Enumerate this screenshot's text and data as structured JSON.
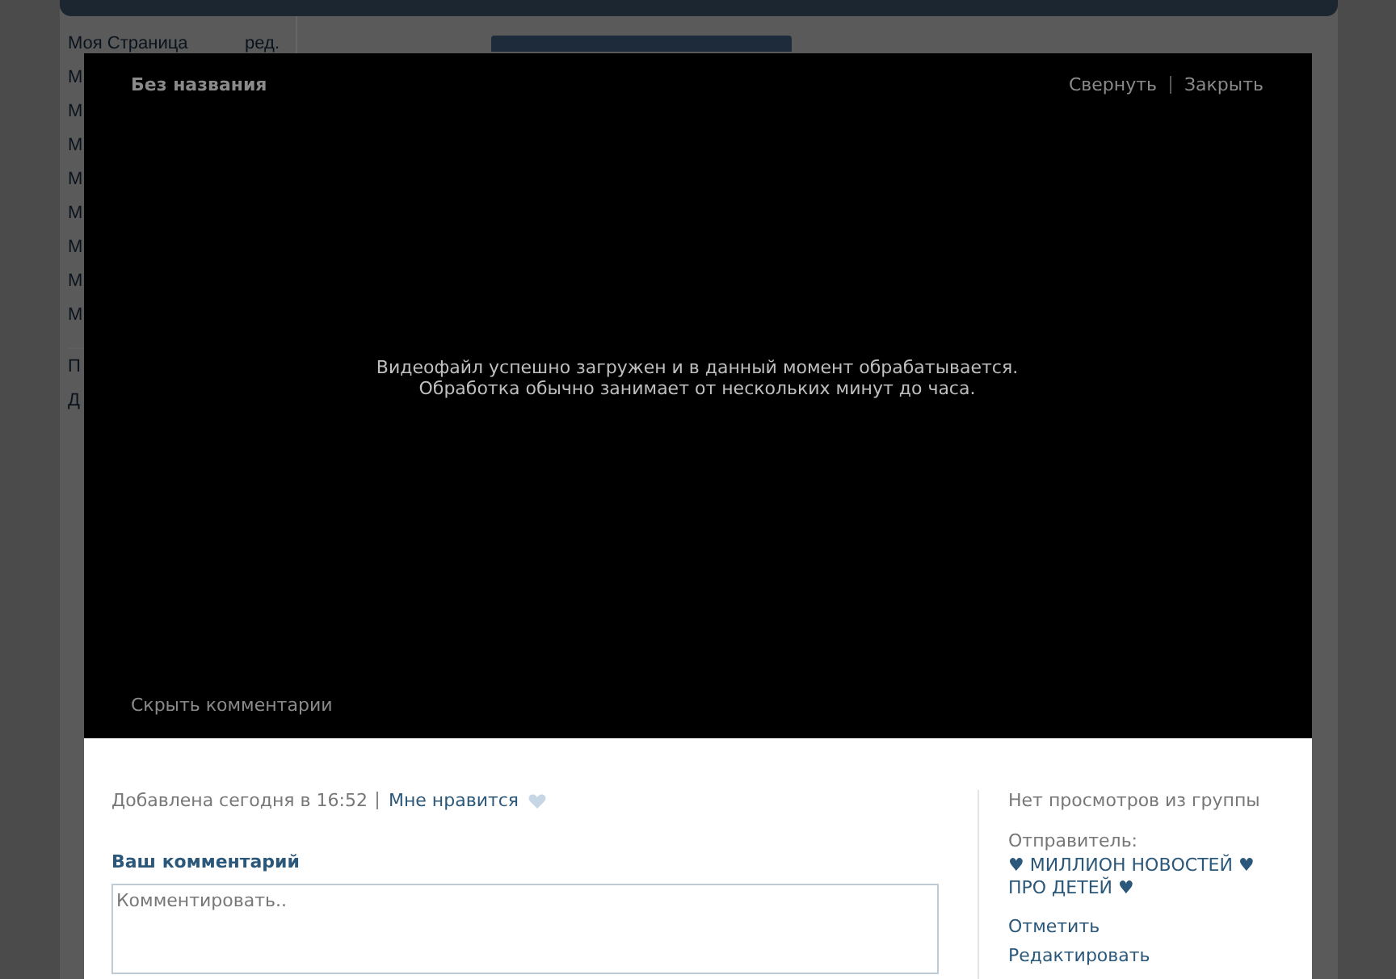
{
  "page": {
    "sidebar": {
      "items": [
        {
          "label": "Моя Страница",
          "edit": "ред."
        },
        {
          "label": "М"
        },
        {
          "label": "М"
        },
        {
          "label": "М"
        },
        {
          "label": "М"
        },
        {
          "label": "М"
        },
        {
          "label": "М"
        },
        {
          "label": "М"
        },
        {
          "label": "М"
        }
      ],
      "extra_items": [
        "П",
        "Д"
      ]
    }
  },
  "modal": {
    "title": "Без названия",
    "actions": [
      "Свернуть",
      "Закрыть"
    ],
    "message": [
      "Видеофайл успешно загружен и в данный момент обрабатывается.",
      "Обработка обычно занимает от нескольких минут до часа."
    ],
    "hide_comments": "Скрыть комментарии",
    "added": "Добавлена сегодня в 16:52",
    "like": "Мне нравится",
    "comment_heading": "Ваш комментарий",
    "comment": {
      "placeholder": "Комментировать.."
    },
    "side": {
      "views": "Нет просмотров из группы",
      "sender_label": "Отправитель:",
      "sender": "♥ МИЛЛИОН НОВОСТЕЙ ♥ ПРО ДЕТЕЙ ♥",
      "actions": [
        "Отметить",
        "Редактировать"
      ]
    }
  }
}
